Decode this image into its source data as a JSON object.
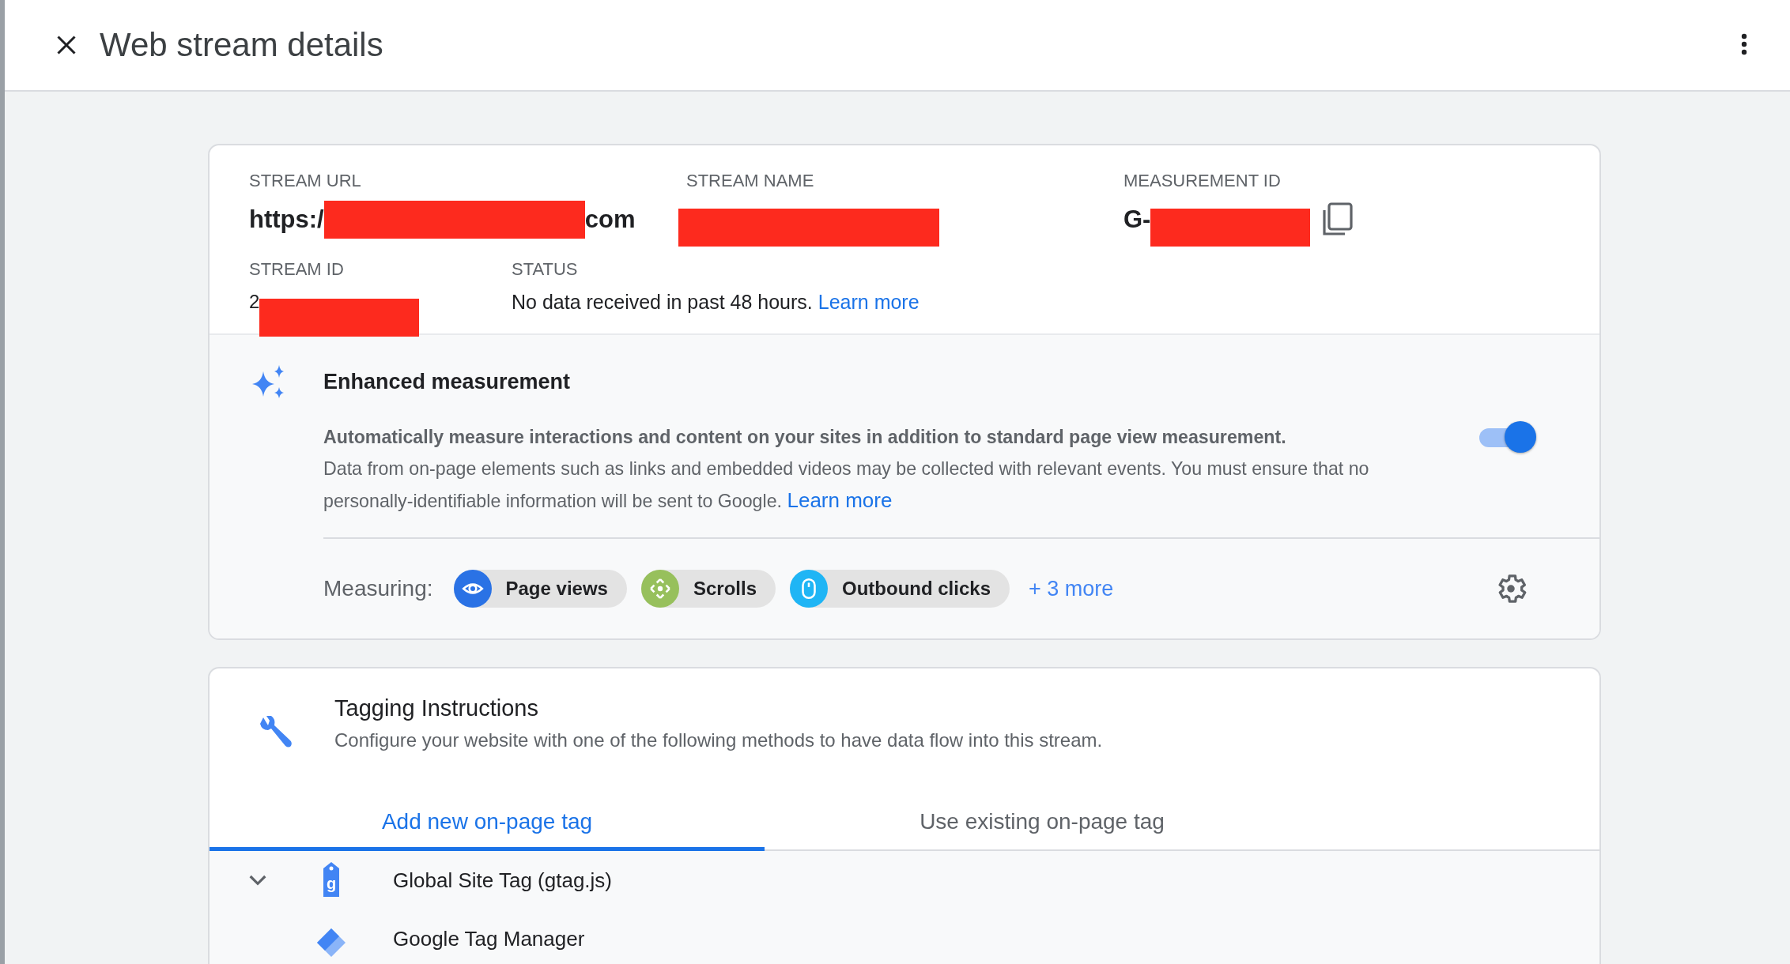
{
  "header": {
    "title": "Web stream details"
  },
  "stream": {
    "fields": [
      {
        "label": "STREAM URL",
        "value_start": "https:/",
        "value_end": "com",
        "redacted": true
      },
      {
        "label": "STREAM NAME",
        "redacted": true
      },
      {
        "label": "MEASUREMENT ID",
        "value_start": "G-",
        "redacted": true,
        "copy": true
      }
    ],
    "id": {
      "label": "STREAM ID",
      "value_start": "2",
      "redacted": true
    },
    "status": {
      "label": "STATUS",
      "text": "No data received in past 48 hours.",
      "link": "Learn more"
    }
  },
  "enhanced": {
    "title": "Enhanced measurement",
    "lead": "Automatically measure interactions and content on your sites in addition to standard page view measurement.",
    "body": "Data from on-page elements such as links and embedded videos may be collected with relevant events. You must ensure that no personally-identifiable information will be sent to Google.",
    "link": "Learn more",
    "on": true,
    "measuring_label": "Measuring:",
    "chips": [
      {
        "label": "Page views",
        "kind": "eye",
        "color": "#2a72e5"
      },
      {
        "label": "Scrolls",
        "kind": "move",
        "color": "#97c05c"
      },
      {
        "label": "Outbound clicks",
        "kind": "mouse",
        "color": "#1fb5f5"
      }
    ],
    "more": "+ 3 more"
  },
  "tagging": {
    "title": "Tagging Instructions",
    "subtitle": "Configure your website with one of the following methods to have data flow into this stream.",
    "tabs": [
      {
        "label": "Add new on-page tag",
        "selected": true
      },
      {
        "label": "Use existing on-page tag",
        "selected": false
      }
    ],
    "methods": [
      {
        "label": "Global Site Tag (gtag.js)",
        "kind": "gtag",
        "icon_letter": "g",
        "expanded": true
      },
      {
        "label": "Google Tag Manager",
        "kind": "gtm"
      }
    ]
  }
}
